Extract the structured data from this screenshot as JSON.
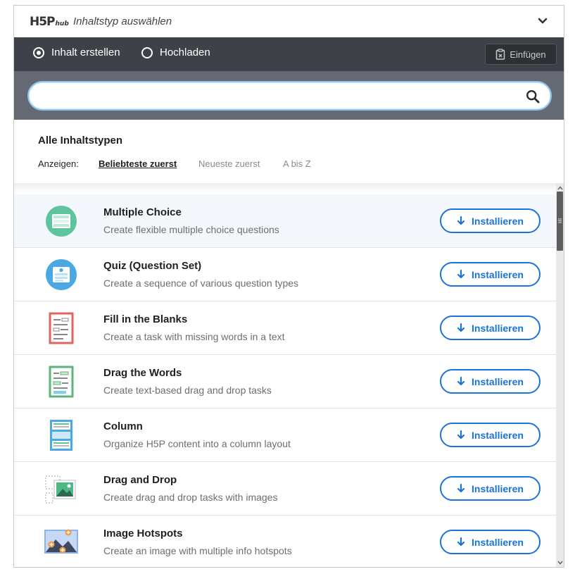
{
  "header": {
    "logo": "H5P",
    "logo_sub": "hub",
    "title": "Inhaltstyp auswählen"
  },
  "tabs": {
    "create": "Inhalt erstellen",
    "upload": "Hochladen",
    "paste": "Einfügen"
  },
  "search": {
    "value": "",
    "placeholder": ""
  },
  "content": {
    "title": "Alle Inhaltstypen",
    "sort_label": "Anzeigen:",
    "sort_popular": "Beliebteste zuerst",
    "sort_newest": "Neueste zuerst",
    "sort_az": "A bis Z"
  },
  "items": [
    {
      "name": "Multiple Choice",
      "desc": "Create flexible multiple choice questions",
      "button": "Installieren",
      "icon": "multiple-choice-icon"
    },
    {
      "name": "Quiz (Question Set)",
      "desc": "Create a sequence of various question types",
      "button": "Installieren",
      "icon": "question-set-icon"
    },
    {
      "name": "Fill in the Blanks",
      "desc": "Create a task with missing words in a text",
      "button": "Installieren",
      "icon": "fill-in-blanks-icon"
    },
    {
      "name": "Drag the Words",
      "desc": "Create text-based drag and drop tasks",
      "button": "Installieren",
      "icon": "drag-the-words-icon"
    },
    {
      "name": "Column",
      "desc": "Organize H5P content into a column layout",
      "button": "Installieren",
      "icon": "column-icon"
    },
    {
      "name": "Drag and Drop",
      "desc": "Create drag and drop tasks with images",
      "button": "Installieren",
      "icon": "drag-and-drop-icon"
    },
    {
      "name": "Image Hotspots",
      "desc": "Create an image with multiple info hotspots",
      "button": "Installieren",
      "icon": "image-hotspots-icon"
    }
  ],
  "colors": {
    "accent": "#1a73d9",
    "tabbar": "#3e4147",
    "searchbar": "#646973"
  }
}
